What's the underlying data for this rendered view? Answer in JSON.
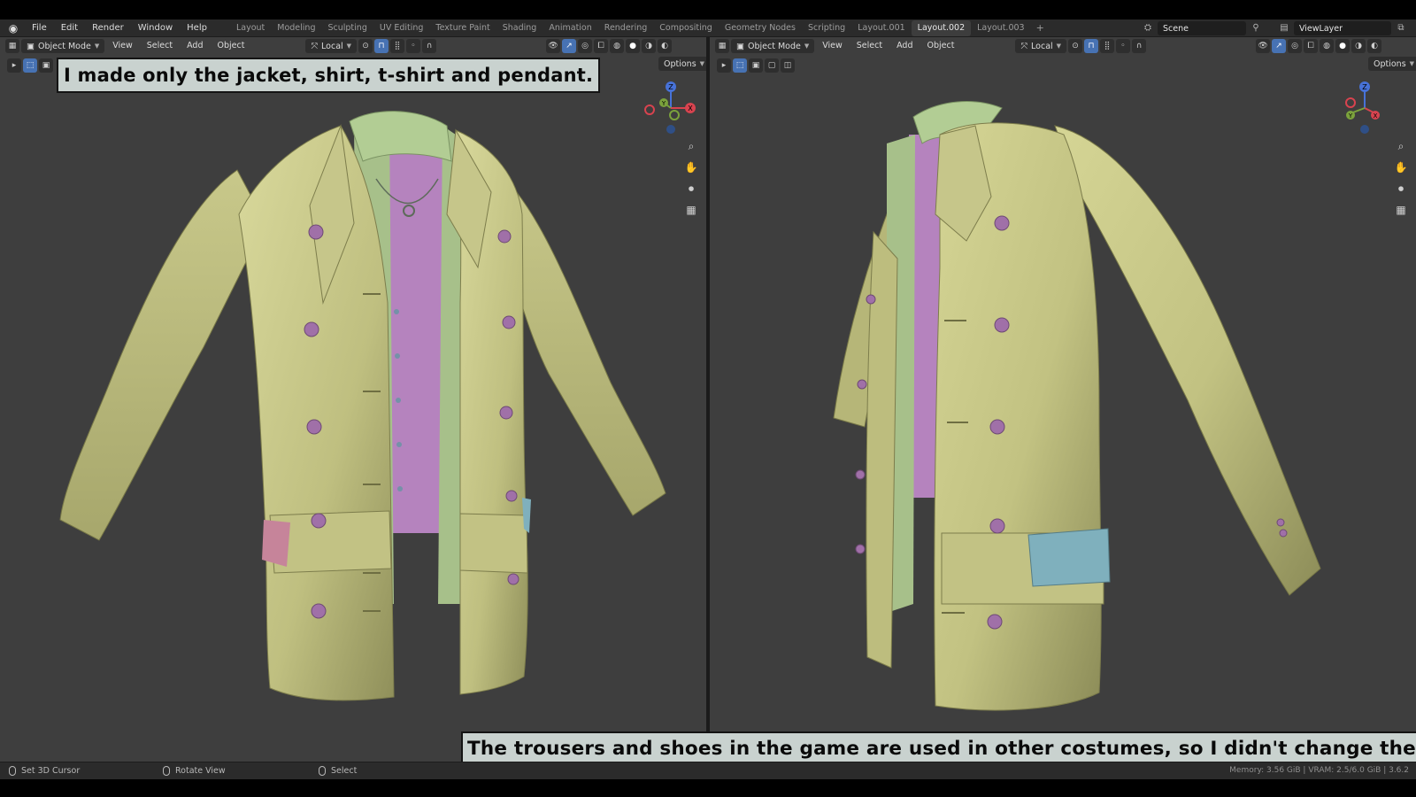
{
  "topbar": {
    "menu": [
      "File",
      "Edit",
      "Render",
      "Window",
      "Help"
    ],
    "workspaces": [
      "Layout",
      "Modeling",
      "Sculpting",
      "UV Editing",
      "Texture Paint",
      "Shading",
      "Animation",
      "Rendering",
      "Compositing",
      "Geometry Nodes",
      "Scripting",
      "Layout.001",
      "Layout.002",
      "Layout.003"
    ],
    "active_workspace": "Layout.002",
    "add_workspace": "+",
    "scene": "Scene",
    "view_layer": "ViewLayer"
  },
  "viewport_left": {
    "mode": "Object Mode",
    "menus": [
      "View",
      "Select",
      "Add",
      "Object"
    ],
    "transform_orientation": "Local",
    "options": "Options"
  },
  "viewport_right": {
    "mode": "Object Mode",
    "menus": [
      "View",
      "Select",
      "Add",
      "Object"
    ],
    "transform_orientation": "Local",
    "options": "Options"
  },
  "gizmo_axes": {
    "x": "X",
    "y": "Y",
    "z": "Z"
  },
  "captions": {
    "top": "I made only the jacket, shirt, t-shirt and pendant.",
    "bottom": "The trousers and shoes in the game are used in other costumes, so I didn't change them."
  },
  "statusbar": {
    "left_action": "Set 3D Cursor",
    "middle_action": "Rotate View",
    "right_action": "Select",
    "stats": "Memory: 3.56 GiB | VRAM: 2.5/6.0 GiB | 3.6.2"
  },
  "colors": {
    "jacket": "#c8c98a",
    "shirt": "#a7c08a",
    "tshirt": "#b583be",
    "buttons": "#a070a8",
    "pocket_flap_left": "#c6849a",
    "pocket_flap_right": "#7fb0bd",
    "viewport_bg": "#3e3e3e",
    "active_blue": "#4772b3"
  }
}
